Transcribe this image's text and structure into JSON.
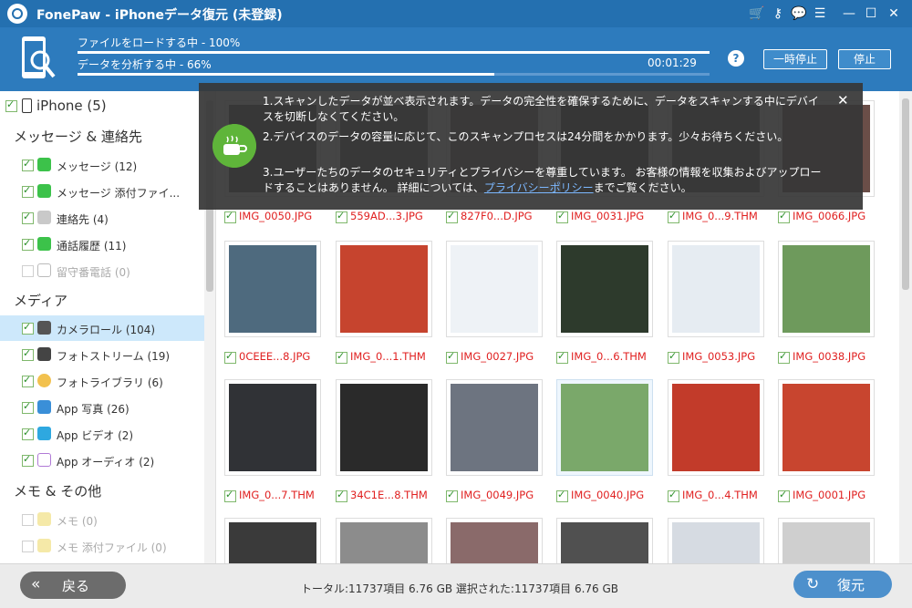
{
  "window": {
    "title": "FonePaw - iPhoneデータ復元 (未登録)",
    "titlebar_icons": [
      "cart-icon",
      "key-icon",
      "chat-icon",
      "feedback-icon",
      "minimize-icon",
      "maximize-icon",
      "close-icon"
    ]
  },
  "scan": {
    "load_label": "ファイルをロードする中 - 100%",
    "load_progress": 1.0,
    "analyze_label": "データを分析する中 - 66%",
    "analyze_progress": 0.66,
    "elapsed": "00:01:29",
    "help_label": "?",
    "pause_label": "一時停止",
    "stop_label": "停止"
  },
  "sidebar": {
    "device": "iPhone (5)",
    "sections": [
      {
        "title": "メッセージ & 連絡先",
        "items": [
          {
            "label": "メッセージ (12)",
            "icon": "messages-icon",
            "checked": true,
            "enabled": true
          },
          {
            "label": "メッセージ 添付ファイ...",
            "icon": "message-attachment-icon",
            "checked": true,
            "enabled": true
          },
          {
            "label": "連絡先 (4)",
            "icon": "contacts-icon",
            "checked": true,
            "enabled": true
          },
          {
            "label": "通話履歴 (11)",
            "icon": "call-history-icon",
            "checked": true,
            "enabled": true
          },
          {
            "label": "留守番電話 (0)",
            "icon": "voicemail-icon",
            "checked": false,
            "enabled": false
          }
        ]
      },
      {
        "title": "メディア",
        "items": [
          {
            "label": "カメラロール (104)",
            "icon": "camera-roll-icon",
            "checked": true,
            "enabled": true,
            "selected": true
          },
          {
            "label": "フォトストリーム (19)",
            "icon": "photo-stream-icon",
            "checked": true,
            "enabled": true
          },
          {
            "label": "フォトライブラリ (6)",
            "icon": "photo-library-icon",
            "checked": true,
            "enabled": true
          },
          {
            "label": "App 写真 (26)",
            "icon": "app-photos-icon",
            "checked": true,
            "enabled": true
          },
          {
            "label": "App ビデオ (2)",
            "icon": "app-video-icon",
            "checked": true,
            "enabled": true
          },
          {
            "label": "App オーディオ (2)",
            "icon": "app-audio-icon",
            "checked": true,
            "enabled": true
          }
        ]
      },
      {
        "title": "メモ & その他",
        "items": [
          {
            "label": "メモ (0)",
            "icon": "notes-icon",
            "checked": false,
            "enabled": false
          },
          {
            "label": "メモ 添付ファイル (0)",
            "icon": "notes-attachment-icon",
            "checked": false,
            "enabled": false
          }
        ]
      }
    ]
  },
  "tip": {
    "line1": "1.スキャンしたデータが並べ表示されます。データの完全性を確保するために、データをスキャンする中にデバイスを切断しなくてください。",
    "line2": "2.デバイスのデータの容量に応じて、このスキャンプロセスは24分間をかかります。少々お待ちください。",
    "line3_before": "3.ユーザーたちのデータのセキュリティとプライバシーを尊重しています。 お客様の情報を収集およびアップロードすることはありません。 詳細については、",
    "line3_link": "プライバシーポリシー",
    "line3_after": "までご覧ください。"
  },
  "grid": {
    "rows": [
      [
        {
          "name": "IMG_0050.JPG",
          "color": "#3b3b3b"
        },
        {
          "name": "559AD...3.JPG",
          "color": "#4a4a4a"
        },
        {
          "name": "827F0...D.JPG",
          "color": "#6b5a55"
        },
        {
          "name": "IMG_0031.JPG",
          "color": "#2f2f34"
        },
        {
          "name": "IMG_0...9.THM",
          "color": "#505050"
        },
        {
          "name": "IMG_0066.JPG",
          "color": "#6a4e48"
        }
      ],
      [
        {
          "name": "0CEEE...8.JPG",
          "color": "#4e6a7e"
        },
        {
          "name": "IMG_0...1.THM",
          "color": "#c6442e"
        },
        {
          "name": "IMG_0027.JPG",
          "color": "#eef2f6"
        },
        {
          "name": "IMG_0...6.THM",
          "color": "#2d3a2c"
        },
        {
          "name": "IMG_0053.JPG",
          "color": "#e6ecf2"
        },
        {
          "name": "IMG_0038.JPG",
          "color": "#6e9a5c"
        }
      ],
      [
        {
          "name": "IMG_0...7.THM",
          "color": "#303236"
        },
        {
          "name": "34C1E...8.THM",
          "color": "#2a2a2a"
        },
        {
          "name": "IMG_0049.JPG",
          "color": "#6d7480"
        },
        {
          "name": "IMG_0040.JPG",
          "color": "#7aa86a",
          "highlight": true
        },
        {
          "name": "IMG_0...4.THM",
          "color": "#c23b2a"
        },
        {
          "name": "IMG_0001.JPG",
          "color": "#c8452f"
        }
      ],
      [
        {
          "name": "",
          "color": "#3a3a3a"
        },
        {
          "name": "",
          "color": "#8c8c8c"
        },
        {
          "name": "",
          "color": "#8a6a6a"
        },
        {
          "name": "",
          "color": "#505050"
        },
        {
          "name": "",
          "color": "#d6dbe2"
        },
        {
          "name": "",
          "color": "#cfcfcf"
        }
      ]
    ]
  },
  "footer": {
    "back_label": "戻る",
    "stats": "トータル:11737項目 6.76 GB   選択された:11737項目 6.76 GB",
    "restore_label": "復元"
  }
}
